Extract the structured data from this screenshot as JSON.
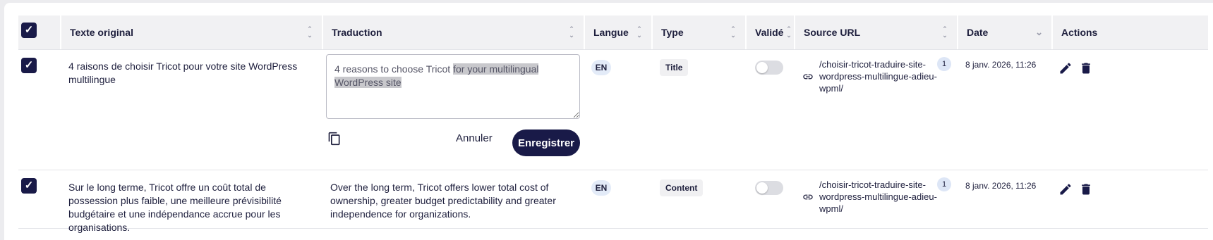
{
  "header": {
    "select_all_check": "✓",
    "columns": [
      {
        "key": "original",
        "label": "Texte original"
      },
      {
        "key": "translation",
        "label": "Traduction"
      },
      {
        "key": "language",
        "label": "Langue"
      },
      {
        "key": "type",
        "label": "Type"
      },
      {
        "key": "validated",
        "label": "Validé"
      },
      {
        "key": "source_url",
        "label": "Source URL"
      },
      {
        "key": "date",
        "label": "Date"
      },
      {
        "key": "actions",
        "label": "Actions"
      }
    ]
  },
  "rows": [
    {
      "checked": true,
      "check": "✓",
      "original": "4 raisons de choisir Tricot pour votre site WordPress multilingue",
      "translation_plain": "4 reasons to choose Tricot ",
      "translation_selected": "for your multilingual WordPress site",
      "editing": true,
      "language": "EN",
      "type": "Title",
      "validated": false,
      "source_url": "/choisir-tricot-traduire-site-wordpress-multilingue-adieu-wpml/",
      "url_count": "1",
      "date": "8 janv. 2026, 11:26",
      "cancel_label": "Annuler",
      "save_label": "Enregistrer"
    },
    {
      "checked": true,
      "check": "✓",
      "original": "Sur le long terme, Tricot offre un coût total de possession plus faible, une meilleure prévisibilité budgétaire et une indépendance accrue pour les organisations.",
      "translation": "Over the long term, Tricot offers lower total cost of ownership, greater budget predictability and greater independence for organizations.",
      "editing": false,
      "language": "EN",
      "type": "Content",
      "validated": false,
      "source_url": "/choisir-tricot-traduire-site-wordpress-multilingue-adieu-wpml/",
      "url_count": "1",
      "date": "8 janv. 2026, 11:26"
    }
  ],
  "colors": {
    "primary": "#191a48",
    "badge_bg": "#e3ebf8",
    "header_bg": "#f1f1f3"
  },
  "icons": [
    "check-icon",
    "sort-icon",
    "chevron-down-icon",
    "copy-icon",
    "link-icon",
    "edit-icon",
    "delete-icon"
  ]
}
